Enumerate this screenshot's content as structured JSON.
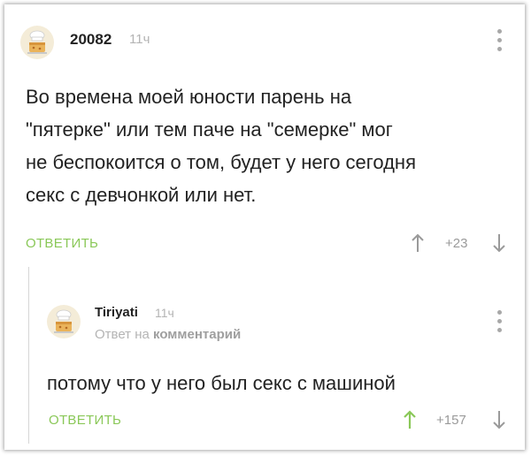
{
  "comment": {
    "username": "20082",
    "time": "11ч",
    "lines": [
      "Во времена моей юности парень на",
      "\"пятерке\" или тем паче на \"семерке\" мог",
      "не беспокоится о том, будет у него сегодня",
      "секс с девчонкой или нет."
    ],
    "reply_label": "ответить",
    "rating": "+23"
  },
  "reply": {
    "username": "Tiriyati",
    "time": "11ч",
    "reply_to_prefix": "Ответ на",
    "reply_to_target": "комментарий",
    "text": "потому что у него был секс с машиной",
    "reply_label": "ответить",
    "rating": "+157"
  },
  "colors": {
    "accent_green": "#8ac858",
    "muted_gray": "#b4b4b4",
    "text_dark": "#222222"
  }
}
